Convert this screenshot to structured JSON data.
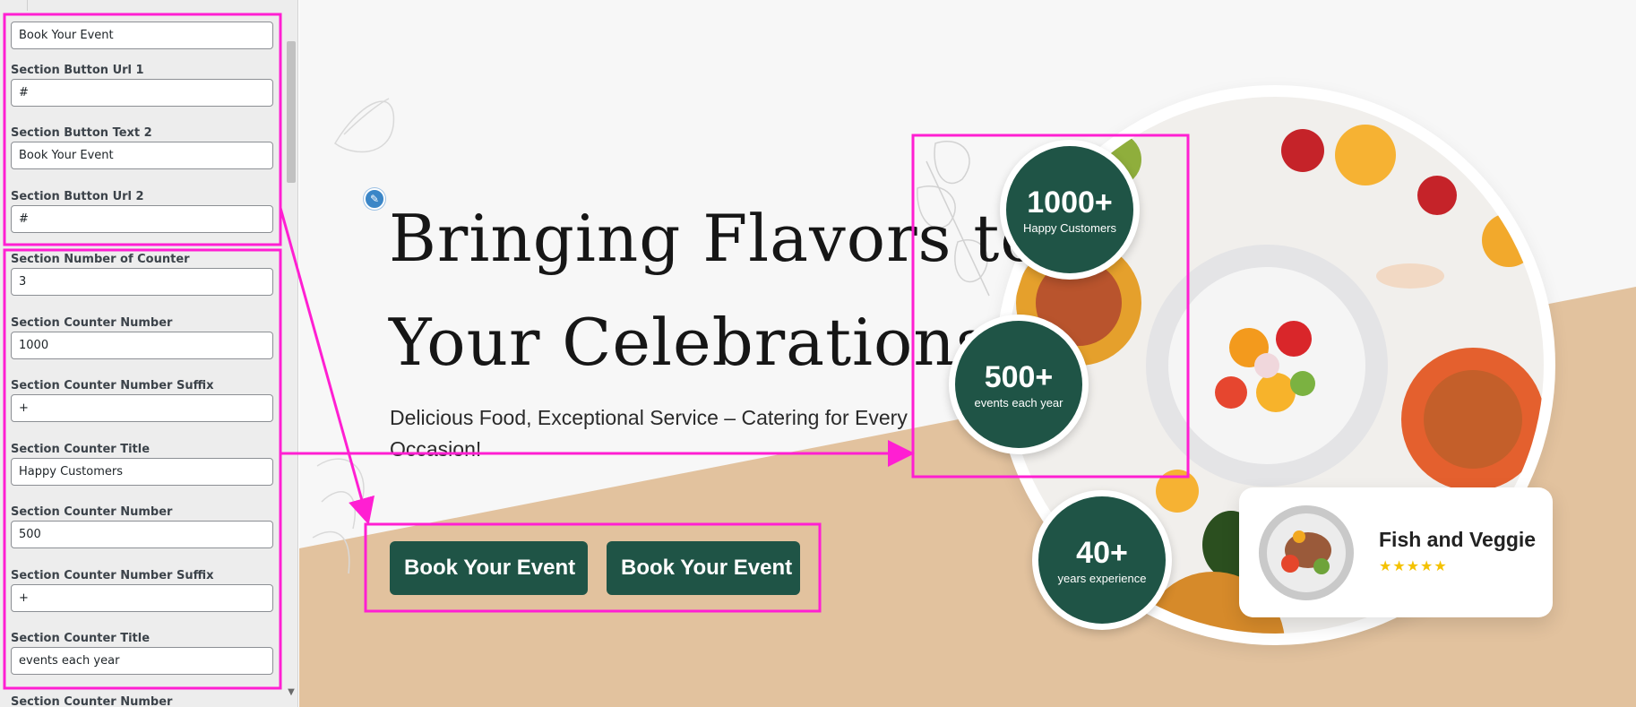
{
  "customizer": {
    "fields": [
      {
        "label": "",
        "value": "Book Your Event"
      },
      {
        "label": "Section Button Url 1",
        "value": "#"
      },
      {
        "label": "Section Button Text 2",
        "value": "Book Your Event"
      },
      {
        "label": "Section Button Url 2",
        "value": "#"
      },
      {
        "label": "Section Number of Counter",
        "value": "3"
      },
      {
        "label": "Section Counter Number",
        "value": "1000"
      },
      {
        "label": "Section Counter Number Suffix",
        "value": "+"
      },
      {
        "label": "Section Counter Title",
        "value": "Happy Customers"
      },
      {
        "label": "Section Counter Number",
        "value": "500"
      },
      {
        "label": "Section Counter Number Suffix",
        "value": "+"
      },
      {
        "label": "Section Counter Title",
        "value": "events each year"
      },
      {
        "label": "Section Counter Number",
        "value": ""
      }
    ]
  },
  "hero": {
    "headline_line1": "Bringing Flavors to",
    "headline_line2": "Your Celebrations",
    "subtext": "Delicious Food, Exceptional Service – Catering for Every Occasion!",
    "button1": "Book Your Event",
    "button2": "Book Your Event",
    "counters": [
      {
        "number": "1000+",
        "title": "Happy Customers"
      },
      {
        "number": "500+",
        "title": "events each year"
      },
      {
        "number": "40+",
        "title": "years experience"
      }
    ],
    "card": {
      "title": "Fish and Veggie",
      "stars": "★★★★★",
      "rating": 5
    }
  },
  "colors": {
    "brand_green": "#1f5446",
    "beige": "#e2c29e",
    "annotation": "#ff1fd2",
    "star": "#f4c200"
  },
  "icons": {
    "edit": "pencil-icon",
    "scroll": "chevron-down-icon"
  }
}
